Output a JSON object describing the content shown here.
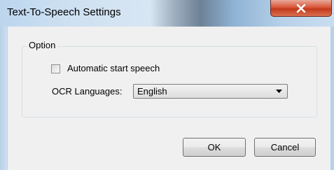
{
  "window": {
    "title": "Text-To-Speech Settings",
    "close_icon": "close-x-icon"
  },
  "group": {
    "legend": "Option"
  },
  "auto_speech": {
    "label": "Automatic start speech",
    "checked": false
  },
  "ocr": {
    "label": "OCR Languages:",
    "selected": "English"
  },
  "buttons": {
    "ok": "OK",
    "cancel": "Cancel"
  },
  "colors": {
    "close_button": "#c9432a",
    "dialog_background": "#f0f0f0"
  }
}
